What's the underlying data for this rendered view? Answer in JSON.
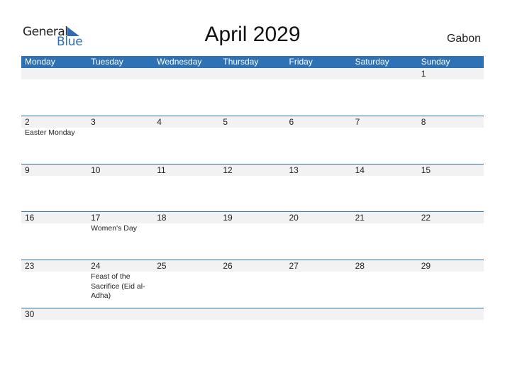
{
  "logo": {
    "general": "General",
    "blue": "Blue"
  },
  "title": "April 2029",
  "country": "Gabon",
  "colors": {
    "header_bg": "#2E71B4",
    "day_row_bg": "#F2F2F2",
    "brand": "#2E6DB4"
  },
  "weekdays": [
    "Monday",
    "Tuesday",
    "Wednesday",
    "Thursday",
    "Friday",
    "Saturday",
    "Sunday"
  ],
  "weeks": [
    {
      "days": [
        "",
        "",
        "",
        "",
        "",
        "",
        "1"
      ],
      "events": [
        "",
        "",
        "",
        "",
        "",
        "",
        ""
      ]
    },
    {
      "days": [
        "2",
        "3",
        "4",
        "5",
        "6",
        "7",
        "8"
      ],
      "events": [
        "Easter Monday",
        "",
        "",
        "",
        "",
        "",
        ""
      ]
    },
    {
      "days": [
        "9",
        "10",
        "11",
        "12",
        "13",
        "14",
        "15"
      ],
      "events": [
        "",
        "",
        "",
        "",
        "",
        "",
        ""
      ]
    },
    {
      "days": [
        "16",
        "17",
        "18",
        "19",
        "20",
        "21",
        "22"
      ],
      "events": [
        "",
        "Women's Day",
        "",
        "",
        "",
        "",
        ""
      ]
    },
    {
      "days": [
        "23",
        "24",
        "25",
        "26",
        "27",
        "28",
        "29"
      ],
      "events": [
        "",
        "Feast of the Sacrifice (Eid al-Adha)",
        "",
        "",
        "",
        "",
        ""
      ]
    },
    {
      "days": [
        "30",
        "",
        "",
        "",
        "",
        "",
        ""
      ],
      "events": [
        "",
        "",
        "",
        "",
        "",
        "",
        ""
      ]
    }
  ]
}
